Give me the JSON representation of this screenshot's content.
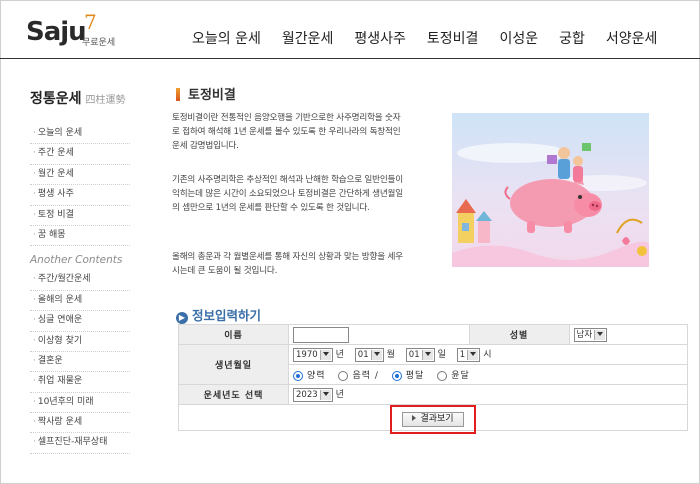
{
  "header": {
    "logo_text": "Saju",
    "logo_number": "7",
    "logo_sub": "무료운세",
    "nav": [
      "오늘의 운세",
      "월간운세",
      "평생사주",
      "토정비결",
      "이성운",
      "궁합",
      "서양운세"
    ]
  },
  "sidebar": {
    "title": "정통운세",
    "title_hanja": "四柱運勢",
    "items": [
      "오늘의 운세",
      "주간 운세",
      "월간 운세",
      "평생 사주",
      "토정 비결",
      "꿈 해몽"
    ],
    "another_title": "Another Contents",
    "items2": [
      "주간/월간운세",
      "올해의 운세",
      "싱글 연애운",
      "이상형 찾기",
      "결혼운",
      "취업 재물운",
      "10년후의 미래",
      "짝사랑 운세",
      "셀프진단-재무상태"
    ]
  },
  "main": {
    "title": "토정비결",
    "para1": "토정비결이란 전통적인 음양오행을 기반으로한 사주명리학을 숫자로 접하여 해석해 1년 운세를 볼수 있도록 한 우리나라의 독창적인 운세 감명법입니다.",
    "para2": "기존의 사주명리학은 추상적인 해석과 난해한 학습으로 일반인들이 익히는데 많은 시간이 소요되었으나 토정비결은 간단하게 생년월일의 셈만으로 1년의 운세를 판단할 수 있도록 한 것입니다.",
    "para3": "올해의 총운과 각 월별운세를 통해 자신의 상황과 맞는 방향을 세우시는데 큰 도움이 될 것입니다."
  },
  "form": {
    "title": "정보입력하기",
    "name_label": "이름",
    "name_value": "",
    "gender_label": "성별",
    "gender_value": "남자",
    "birth_label": "생년월일",
    "year_value": "1970",
    "year_unit": "년",
    "month_value": "01",
    "month_unit": "월",
    "day_value": "01",
    "day_unit": "일",
    "hour_value": "1",
    "hour_unit": "시",
    "calendar_options": [
      "양력",
      "음력 /",
      "평달",
      "윤달"
    ],
    "calendar_selected": [
      "양력",
      "평달"
    ],
    "fortune_year_label": "운세년도 선택",
    "fortune_year_value": "2023",
    "fortune_year_unit": "년",
    "submit_label": "결과보기"
  },
  "colors": {
    "accent_blue": "#3b6fa8",
    "highlight_red": "#e11d1d",
    "logo_orange": "#e08a1e",
    "radio_blue": "#1f6fd6"
  }
}
